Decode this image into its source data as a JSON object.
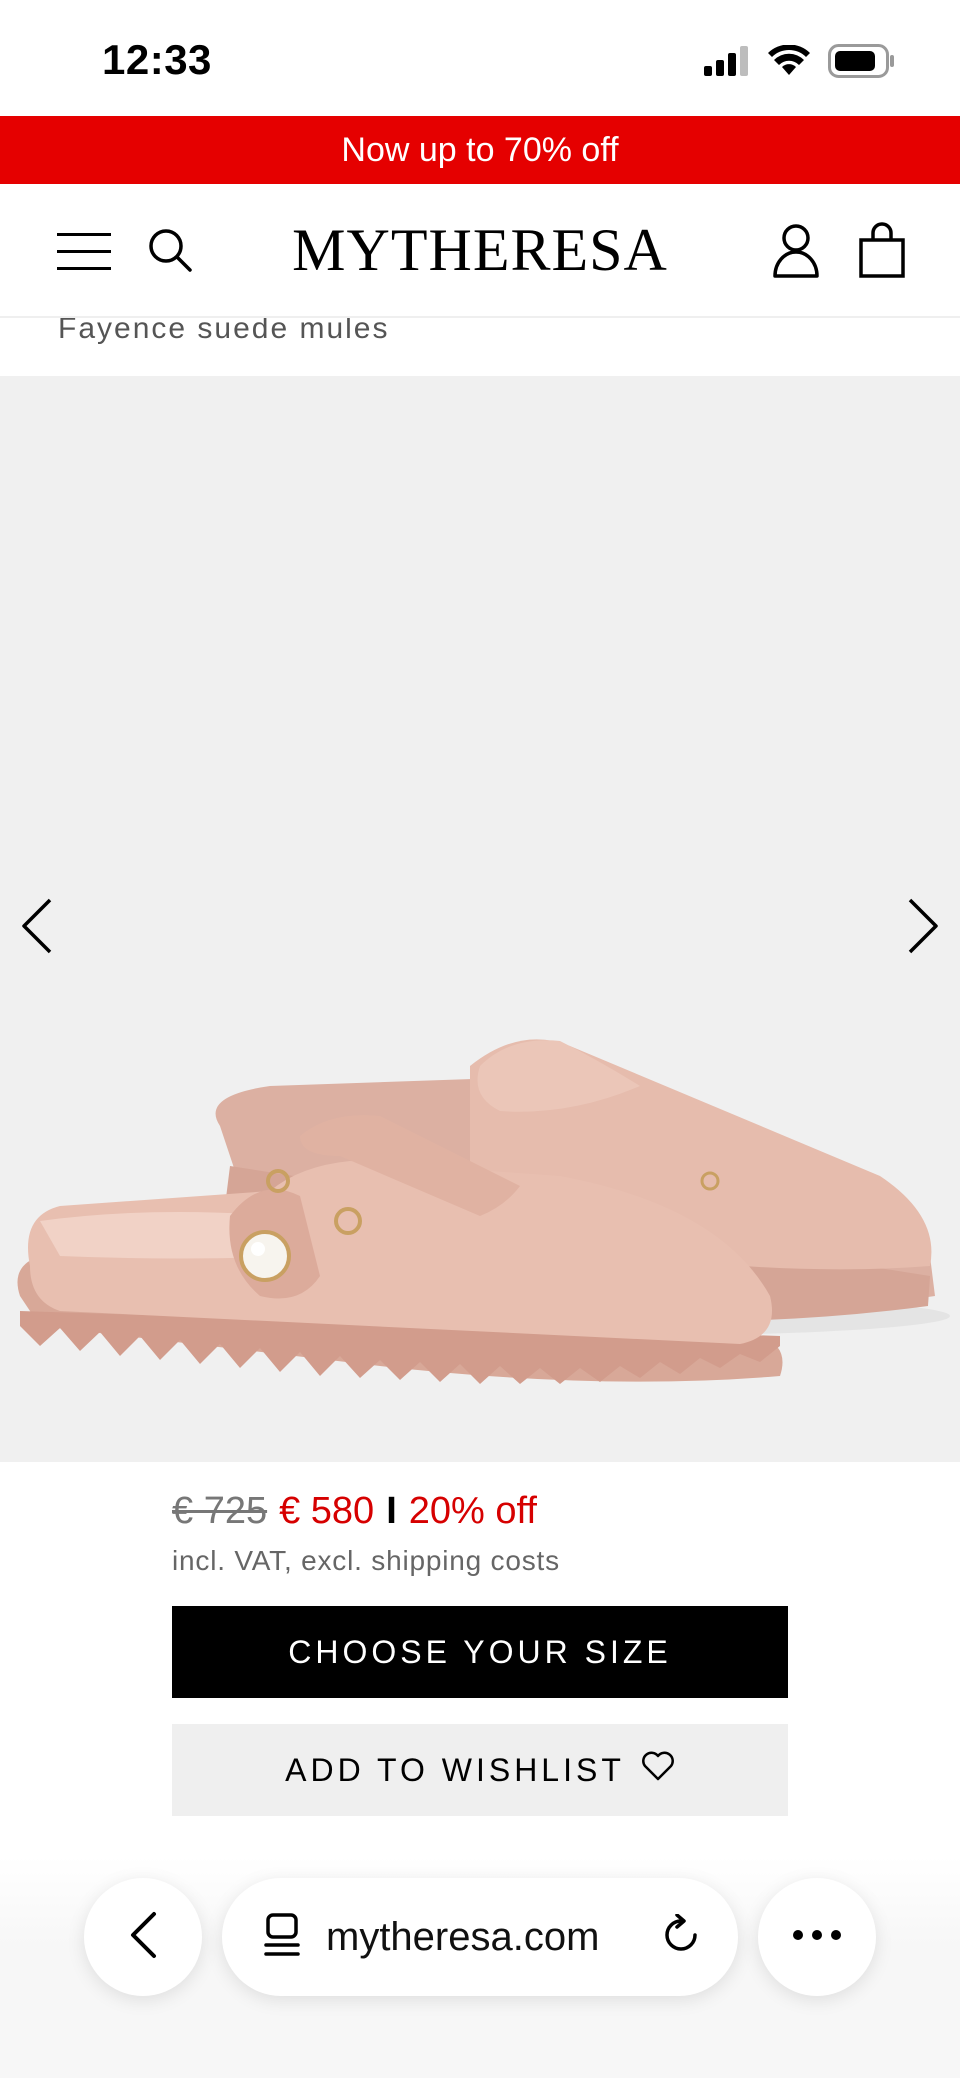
{
  "status_bar": {
    "time": "12:33",
    "icons": [
      "signal-icon",
      "wifi-icon",
      "battery-icon"
    ]
  },
  "promo_banner": {
    "text": "Now up to 70% off",
    "color": "#e50000"
  },
  "header": {
    "logo": "MYTHERESA",
    "icons": [
      "menu-icon",
      "search-icon",
      "account-icon",
      "bag-icon"
    ]
  },
  "product": {
    "name": "Fayence suede mules",
    "price_original": "€ 725",
    "price_sale": "€ 580",
    "separator": "I",
    "discount": "20% off",
    "vat_note": "incl. VAT, excl. shipping costs"
  },
  "gallery": {
    "background": "#f0f0f0",
    "icons": [
      "chevron-left-icon",
      "chevron-right-icon"
    ]
  },
  "actions": {
    "choose_size_label": "CHOOSE YOUR SIZE",
    "wishlist_label": "ADD TO WISHLIST"
  },
  "browser": {
    "url": "mytheresa.com",
    "icons": [
      "back-icon",
      "tabs-icon",
      "reload-icon",
      "more-icon"
    ]
  }
}
